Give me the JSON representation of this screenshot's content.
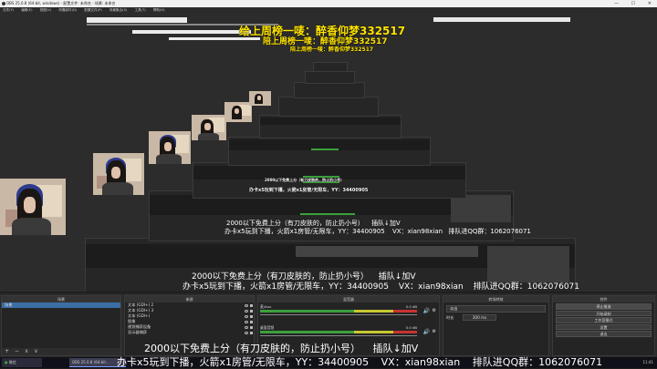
{
  "window": {
    "title": "OBS 25.0.8 (64-bit, windows) - 配置文件: 未命名 - 场景: 未命名",
    "min": "—",
    "max": "☐",
    "close": "✕"
  },
  "menu": [
    "文件(F)",
    "编辑(E)",
    "视图(V)",
    "停靠部件(D)",
    "配置文件(P)",
    "场景集合(S)",
    "工具(T)",
    "帮助(H)"
  ],
  "overlay": {
    "rank_top": "给上周榜一唛：醉香仰梦332517",
    "rank_mid": "陪上周榜一唛：醉香仰梦332517",
    "line_a1": "2000以下免费上分（有刀皮肤的，防止扔小号）",
    "line_a2": "插队↓加V",
    "line_b1": "办卡x5玩到下播，火箭x1房管/无限车，YY：34400905",
    "line_b2": "VX：xian98xian",
    "line_b3": "排队进QQ群：1062076071"
  },
  "docks": {
    "scenes": {
      "title": "场景",
      "items": [
        "场景"
      ]
    },
    "sources": {
      "title": "来源",
      "items": [
        "文本 (GDI+) 2",
        "文本 (GDI+) 3",
        "文本 (GDI+)",
        "图像",
        "视频捕获设备",
        "显示器捕获"
      ]
    },
    "mixer": {
      "title": "混音器",
      "ch1": "麦/Aux",
      "ch2": "桌面音频",
      "ch1_db": "0.0 dB",
      "ch2_db": "0.0 dB"
    },
    "transitions": {
      "title": "转场特效",
      "type": "淡出",
      "duration_label": "时长",
      "duration": "300 ms"
    },
    "controls": {
      "title": "控件",
      "buttons": [
        "停止推流",
        "开始录制",
        "工作室模式",
        "设置",
        "退出"
      ]
    }
  },
  "footer": {
    "add": "+",
    "remove": "−",
    "up": "∧",
    "down": "∨",
    "gear": "⚙"
  },
  "taskbar": {
    "start_label": "微信",
    "obs_label": "OBS 25.0.8 (64-bit...",
    "time": "11:41"
  },
  "colors": {
    "accent": "#3a6ea5",
    "yellow": "#ffe400",
    "green": "#3aa03a"
  }
}
